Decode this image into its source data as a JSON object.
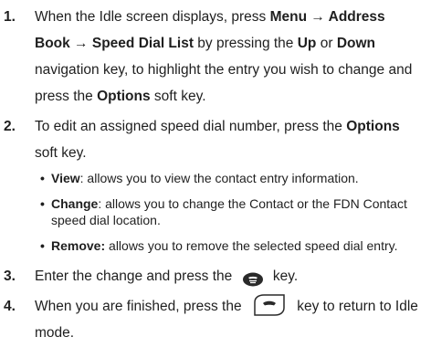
{
  "steps": [
    {
      "num": "1.",
      "parts": [
        "When the Idle screen displays, press ",
        "Menu",
        " → ",
        "Address Book",
        " → ",
        "Speed Dial List",
        " by pressing the ",
        "Up",
        " or ",
        "Down",
        " navigation key, to highlight the entry you wish to change and press the ",
        "Options",
        " soft key."
      ]
    },
    {
      "num": "2.",
      "parts": [
        "To edit an assigned speed dial number, press the ",
        "Options",
        " soft key."
      ]
    },
    {
      "num": "3.",
      "before": "Enter the change and press the ",
      "after": " key."
    },
    {
      "num": "4.",
      "before": "When you are finished, press the ",
      "after": " key to return to Idle mode."
    }
  ],
  "bullets": [
    {
      "term": "View",
      "text": ": allows you to view the contact entry information."
    },
    {
      "term": "Change",
      "text": ": allows you to change the Contact or the FDN Contact speed dial location."
    },
    {
      "term": "Remove:",
      "text": " allows you to remove the selected speed dial entry."
    }
  ],
  "icons": {
    "send_key": "send-key-icon",
    "end_key": "end-key-icon"
  }
}
